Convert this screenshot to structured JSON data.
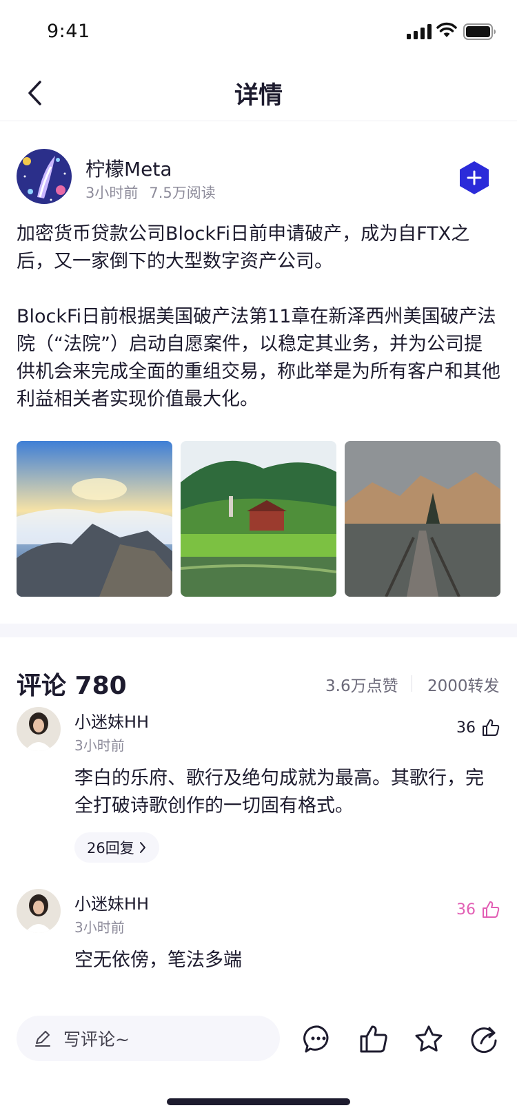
{
  "status_bar": {
    "time": "9:41"
  },
  "nav": {
    "title": "详情"
  },
  "post": {
    "author": "柠檬Meta",
    "time_ago": "3小时前",
    "reads": "7.5万阅读",
    "paragraphs": [
      "加密货币贷款公司BlockFi日前申请破产，成为自FTX之后，又一家倒下的大型数字资产公司。",
      "BlockFi日前根据美国破产法第11章在新泽西州美国破产法院（“法院”）启动自愿案件，以稳定其业务，并为公司提供机会来完成全面的重组交易，称此举是为所有客户和其他利益相关者实现价值最大化。"
    ],
    "images": [
      "mountain-sea-of-clouds",
      "lake-village-valley",
      "foggy-mountain-bridge"
    ]
  },
  "comments_section": {
    "title": "评论 780",
    "likes_total": "3.6万点赞",
    "shares_total": "2000转发",
    "items": [
      {
        "user": "小迷妹HH",
        "time": "3小时前",
        "likes": "36",
        "liked": false,
        "text": "李白的乐府、歌行及绝句成就为最高。其歌行，完全打破诗歌创作的一切固有格式。",
        "replies": "26回复"
      },
      {
        "user": "小迷妹HH",
        "time": "3小时前",
        "likes": "36",
        "liked": true,
        "text": "空无依傍，笔法多端"
      }
    ]
  },
  "bottom_bar": {
    "placeholder": "写评论~",
    "icons": [
      "comment-icon",
      "like-icon",
      "star-icon",
      "share-icon"
    ]
  },
  "colors": {
    "accent": "#2b2bd9",
    "liked": "#e25eb4",
    "text": "#1d1b2e",
    "muted": "#8e8c9b",
    "band": "#f6f6fb"
  }
}
